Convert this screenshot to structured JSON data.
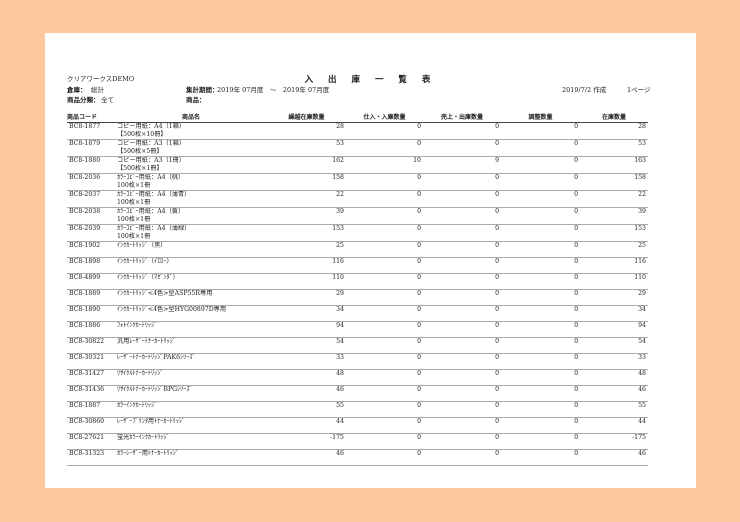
{
  "header": {
    "company": "クリアワークスDEMO",
    "title": "入 出 庫 一 覧 表",
    "warehouse_label": "倉庫：",
    "warehouse_value": "総計",
    "category_label": "商品分類：",
    "category_value": "全て",
    "period_label": "集計期間：",
    "period_value": "2019年 07月度　～　2019年 07月度",
    "product_label": "商品：",
    "created": "2019/7/2 作成",
    "page": "1ページ"
  },
  "columns": [
    "商品コード",
    "商品名",
    "繰越在庫数量",
    "仕入・入庫数量",
    "売上・出庫数量",
    "調整数量",
    "在庫数量"
  ],
  "rows": [
    {
      "code": "BC8-1877",
      "name": "コピー用紙：A4（1箱）",
      "name2": "【500枚×10冊】",
      "carry": "28",
      "in": "0",
      "out": "0",
      "adj": "0",
      "stock": "28"
    },
    {
      "code": "BC8-1879",
      "name": "コピー用紙：A3（1箱）",
      "name2": "【500枚×5冊】",
      "carry": "53",
      "in": "0",
      "out": "0",
      "adj": "0",
      "stock": "53"
    },
    {
      "code": "BC8-1880",
      "name": "コピー用紙：A3（1冊）",
      "name2": "【500枚×1冊】",
      "carry": "162",
      "in": "10",
      "out": "9",
      "adj": "0",
      "stock": "163"
    },
    {
      "code": "BC8-2036",
      "name": "ｶﾗｰｺﾋﾟｰ用紙：A4（桃）",
      "name2": "100枚×1冊",
      "carry": "158",
      "in": "0",
      "out": "0",
      "adj": "0",
      "stock": "158"
    },
    {
      "code": "BC8-2037",
      "name": "ｶﾗｰｺﾋﾟｰ用紙：A4（薄青）",
      "name2": "100枚×1冊",
      "carry": "22",
      "in": "0",
      "out": "0",
      "adj": "0",
      "stock": "22"
    },
    {
      "code": "BC8-2038",
      "name": "ｶﾗｰｺﾋﾟｰ用紙：A4（黄）",
      "name2": "100枚×1冊",
      "carry": "39",
      "in": "0",
      "out": "0",
      "adj": "0",
      "stock": "39"
    },
    {
      "code": "BC8-2039",
      "name": "ｶﾗｰｺﾋﾟｰ用紙：A4（薄緑）",
      "name2": "100枚×1冊",
      "carry": "153",
      "in": "0",
      "out": "0",
      "adj": "0",
      "stock": "153"
    },
    {
      "code": "BC8-1902",
      "name": "ｲﾝｸｶｰﾄﾘｯｼﾞ（黒）",
      "name2": "",
      "carry": "25",
      "in": "0",
      "out": "0",
      "adj": "0",
      "stock": "25"
    },
    {
      "code": "BC8-1898",
      "name": "ｲﾝｸｶｰﾄﾘｯｼﾞ（ｲｴﾛｰ）",
      "name2": "",
      "carry": "116",
      "in": "0",
      "out": "0",
      "adj": "0",
      "stock": "116"
    },
    {
      "code": "BC8-4899",
      "name": "ｲﾝｸｶｰﾄﾘｯｼﾞ（ﾏｾﾞﾝﾀﾞ）",
      "name2": "",
      "carry": "110",
      "in": "0",
      "out": "0",
      "adj": "0",
      "stock": "110"
    },
    {
      "code": "BC8-1889",
      "name": "ｲﾝｸｶｰﾄﾘｯｼﾞ<4色>型ASP55R専用",
      "name2": "",
      "carry": "29",
      "in": "0",
      "out": "0",
      "adj": "0",
      "stock": "29"
    },
    {
      "code": "BC8-1890",
      "name": "ｲﾝｸｶｰﾄﾘｯｼﾞ<4色>型HYG00897D専用",
      "name2": "",
      "carry": "34",
      "in": "0",
      "out": "0",
      "adj": "0",
      "stock": "34"
    },
    {
      "code": "BC8-1886",
      "name": "ﾌｫﾄｲﾝｸｶｰﾄﾘｯｼﾞ",
      "name2": "",
      "carry": "94",
      "in": "0",
      "out": "0",
      "adj": "0",
      "stock": "94"
    },
    {
      "code": "BC8-30822",
      "name": "汎用ﾚｰｻﾞｰﾄﾅｰｶｰﾄﾘｯｼﾞ",
      "name2": "",
      "carry": "54",
      "in": "0",
      "out": "0",
      "adj": "0",
      "stock": "54"
    },
    {
      "code": "BC8-30321",
      "name": "ﾚｰｻﾞｰﾄﾅｰｶｰﾄﾘｯｼﾞPAK6ｼﾘｰｽﾞ",
      "name2": "",
      "carry": "33",
      "in": "0",
      "out": "0",
      "adj": "0",
      "stock": "33"
    },
    {
      "code": "BC8-31427",
      "name": "ﾘｻｲｸﾙﾄﾅｰｶｰﾄﾘｯｼﾞ",
      "name2": "",
      "carry": "48",
      "in": "0",
      "out": "0",
      "adj": "0",
      "stock": "48"
    },
    {
      "code": "BC8-31436",
      "name": "ﾘｻｲｸﾙﾄﾅｰｶｰﾄﾘｯｼﾞBPGｼﾘｰｽﾞ",
      "name2": "",
      "carry": "46",
      "in": "0",
      "out": "0",
      "adj": "0",
      "stock": "46"
    },
    {
      "code": "BC8-1887",
      "name": "ｶﾗｰｲﾝｸｶｰﾄﾘｯｼﾞ",
      "name2": "",
      "carry": "55",
      "in": "0",
      "out": "0",
      "adj": "0",
      "stock": "55"
    },
    {
      "code": "BC8-30860",
      "name": "ﾚｰｻﾞｰﾌﾟﾘﾝﾀ用ﾄﾅｰｶｰﾄﾘｯｼﾞ",
      "name2": "",
      "carry": "44",
      "in": "0",
      "out": "0",
      "adj": "0",
      "stock": "44"
    },
    {
      "code": "BC8-27621",
      "name": "蛍光ｶﾗｰｲﾝｸｶｰﾄﾘｯｼﾞ",
      "name2": "",
      "carry": "-175",
      "in": "0",
      "out": "0",
      "adj": "0",
      "stock": "-175"
    },
    {
      "code": "BC8-31323",
      "name": "ｶﾗｰﾚｰｻﾞｰ用ﾄﾅｰｶｰﾄﾘｯｼﾞ",
      "name2": "",
      "carry": "46",
      "in": "0",
      "out": "0",
      "adj": "0",
      "stock": "46"
    }
  ]
}
